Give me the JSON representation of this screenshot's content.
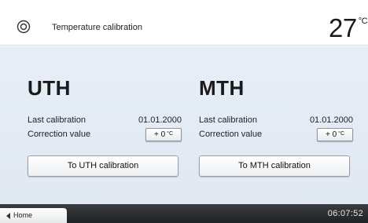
{
  "header": {
    "icon": "target-icon",
    "title": "Temperature calibration",
    "temperature": "27",
    "temperature_unit": "°C"
  },
  "panels": [
    {
      "title": "UTH",
      "last_calibration_label": "Last calibration",
      "last_calibration_value": "01.01.2000",
      "correction_label": "Correction value",
      "correction_value": "+ 0",
      "correction_unit": "°C",
      "button_label": "To UTH calibration"
    },
    {
      "title": "MTH",
      "last_calibration_label": "Last calibration",
      "last_calibration_value": "01.01.2000",
      "correction_label": "Correction value",
      "correction_value": "+ 0",
      "correction_unit": "°C",
      "button_label": "To MTH calibration"
    }
  ],
  "footer": {
    "home_label": "Home",
    "home_icon": "arrow-left-icon",
    "time": "06:07:52"
  }
}
